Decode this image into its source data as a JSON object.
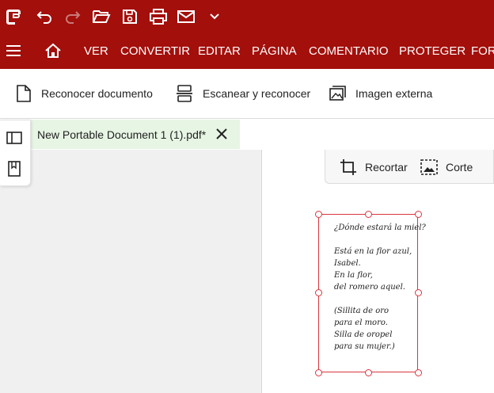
{
  "colors": {
    "brand": "#a30f0b",
    "tab_active_bg": "#e7f5e4",
    "crop_border": "#d9363e"
  },
  "menu": [
    "VER",
    "CONVERTIR",
    "EDITAR",
    "PÁGINA",
    "COMENTARIO",
    "PROTEGER",
    "FOR"
  ],
  "ribbon": {
    "recognize": "Reconocer documento",
    "scan": "Escanear y reconocer",
    "external": "Imagen externa"
  },
  "tab": {
    "label": "New Portable Document 1 (1).pdf*"
  },
  "crop_tool": {
    "crop": "Recortar",
    "cut": "Corte"
  },
  "poem": [
    "¿Dónde estará la miel?",
    "",
    "Está en la flor azul,",
    "Isabel.",
    "En la flor,",
    "del romero aquel.",
    "",
    "(Sillita de oro",
    "para el moro.",
    "Silla de oropel",
    "para su mujer.)"
  ]
}
